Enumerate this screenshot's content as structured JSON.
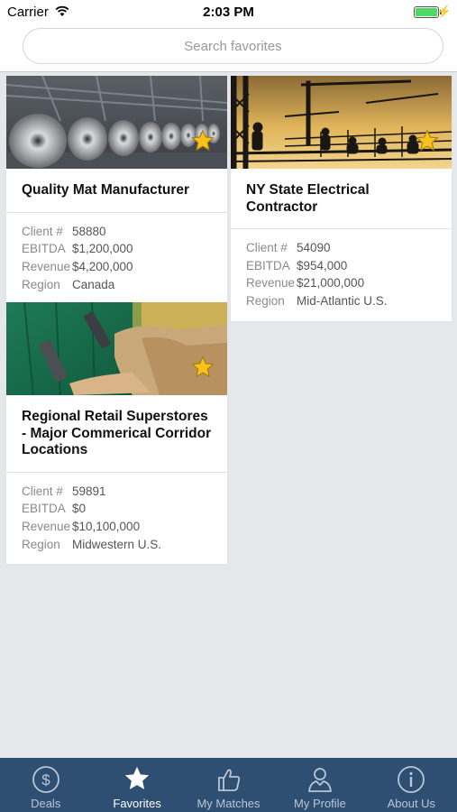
{
  "status_bar": {
    "carrier": "Carrier",
    "time": "2:03 PM"
  },
  "search": {
    "placeholder": "Search favorites"
  },
  "labels": {
    "client": "Client #",
    "ebitda": "EBITDA",
    "revenue": "Revenue",
    "region": "Region"
  },
  "cards": [
    {
      "title": "Quality Mat Manufacturer",
      "client": "58880",
      "ebitda": "$1,200,000",
      "revenue": "$4,200,000",
      "region": "Canada",
      "favorite": true
    },
    {
      "title": "NY State Electrical Contractor",
      "client": "54090",
      "ebitda": "$954,000",
      "revenue": "$21,000,000",
      "region": "Mid-Atlantic U.S.",
      "favorite": true
    },
    {
      "title": "Regional Retail Superstores - Major Commerical Corridor Locations",
      "client": "59891",
      "ebitda": "$0",
      "revenue": "$10,100,000",
      "region": "Midwestern U.S.",
      "favorite": true
    }
  ],
  "tabs": [
    {
      "label": "Deals",
      "icon": "dollar-circle-icon"
    },
    {
      "label": "Favorites",
      "icon": "star-icon",
      "active": true
    },
    {
      "label": "My Matches",
      "icon": "thumbs-up-icon"
    },
    {
      "label": "My Profile",
      "icon": "person-icon"
    },
    {
      "label": "About Us",
      "icon": "info-icon"
    }
  ],
  "colors": {
    "tab_bar": "#2f4f72",
    "star": "#f7c21b",
    "battery": "#4cd964",
    "background": "#e6e7ea"
  }
}
